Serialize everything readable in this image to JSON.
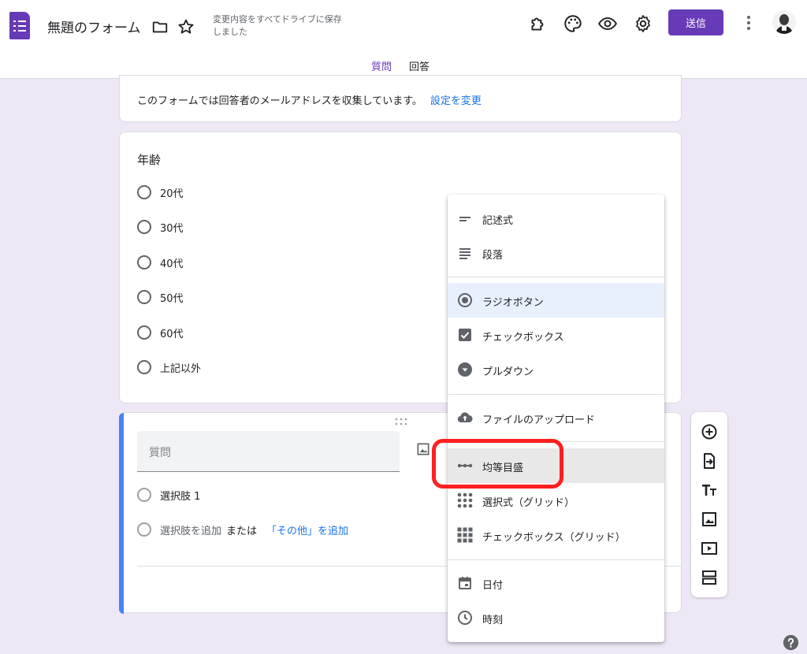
{
  "header": {
    "title": "無題のフォーム",
    "save_status": "変更内容をすべてドライブに保存しました",
    "send_label": "送信",
    "icons": [
      "puzzle-icon",
      "palette-icon",
      "eye-icon",
      "gear-icon",
      "more-vert-icon"
    ]
  },
  "tabs": [
    {
      "label": "質問",
      "active": true
    },
    {
      "label": "回答",
      "active": false
    }
  ],
  "email_notice": {
    "text": "このフォームでは回答者のメールアドレスを収集しています。",
    "link": "設定を変更"
  },
  "age_question": {
    "title": "年齢",
    "options": [
      "20代",
      "30代",
      "40代",
      "50代",
      "60代",
      "上記以外"
    ]
  },
  "editing_question": {
    "placeholder": "質問",
    "option_1": "選択肢 1",
    "add_option": "選択肢を追加",
    "or_text": "または",
    "add_other": "「その他」を追加"
  },
  "type_menu": {
    "items": [
      {
        "label": "記述式",
        "icon": "short-answer-icon"
      },
      {
        "label": "段落",
        "icon": "paragraph-icon"
      },
      {
        "label": "ラジオボタン",
        "icon": "radio-button-icon",
        "selected": true
      },
      {
        "label": "チェックボックス",
        "icon": "checkbox-icon"
      },
      {
        "label": "プルダウン",
        "icon": "dropdown-icon"
      },
      {
        "label": "ファイルのアップロード",
        "icon": "cloud-upload-icon"
      },
      {
        "label": "均等目盛",
        "icon": "linear-scale-icon",
        "highlighted": true
      },
      {
        "label": "選択式（グリッド）",
        "icon": "grid-dots-icon"
      },
      {
        "label": "チェックボックス（グリッド）",
        "icon": "grid-squares-icon"
      },
      {
        "label": "日付",
        "icon": "calendar-icon"
      },
      {
        "label": "時刻",
        "icon": "clock-icon"
      }
    ]
  },
  "colors": {
    "accent": "#673ab7",
    "background": "#ede7f6",
    "active_bar": "#4285f4",
    "highlight": "#ff1f1f",
    "link": "#1a73e8"
  }
}
